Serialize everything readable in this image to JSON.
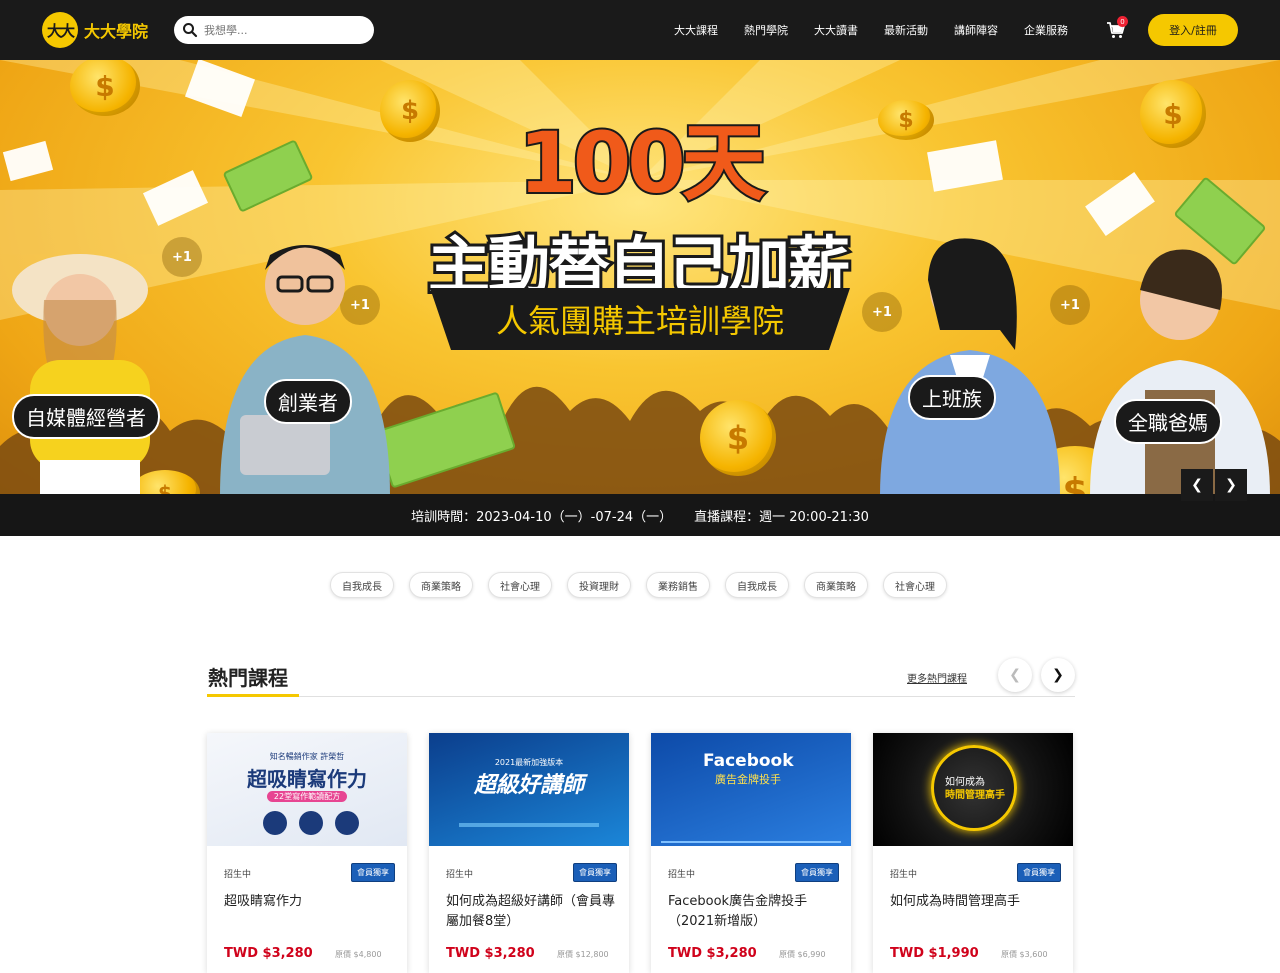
{
  "nav": {
    "logo_mark": "大大",
    "logo_text": "大大學院",
    "search_placeholder": "我想學...",
    "links": [
      "大大課程",
      "熱門學院",
      "大大讀書",
      "最新活動",
      "講師陣容",
      "企業服務"
    ],
    "cart_count": "0",
    "login_label": "登入/註冊"
  },
  "hero": {
    "title": "100天",
    "subtitle": "主動替自己加薪",
    "tagline": "人氣團購主培訓學院",
    "personas": [
      "自媒體經營者",
      "創業者",
      "上班族",
      "全職爸媽"
    ],
    "plus_one": "+1",
    "training_time": "培訓時間：2023-04-10（一）-07-24（一）",
    "live_time": "直播課程：週一 20:00-21:30",
    "prev_icon": "chevron-left-icon",
    "next_icon": "chevron-right-icon"
  },
  "categories": [
    "自我成長",
    "商業策略",
    "社會心理",
    "投資理財",
    "業務銷售",
    "自我成長",
    "商業策略",
    "社會心理"
  ],
  "section": {
    "title": "熱門課程",
    "more_label": "更多熱門課程"
  },
  "courses": [
    {
      "status": "招生中",
      "badge": "會員獨享",
      "title": "超吸睛寫作力",
      "price": "TWD $3,280",
      "original": "原價 $4,800",
      "img_line1": "知名暢銷作家 許榮哲",
      "img_line2": "超吸睛寫作力",
      "img_line3": "22堂寫作範讀配方"
    },
    {
      "status": "招生中",
      "badge": "會員獨享",
      "title": "如何成為超級好講師（會員專屬加餐8堂）",
      "price": "TWD $3,280",
      "original": "原價 $12,800",
      "img_line1": "2021最新加強版本",
      "img_line2": "超級好講師"
    },
    {
      "status": "招生中",
      "badge": "會員獨享",
      "title": "Facebook廣告金牌投手（2021新增版）",
      "price": "TWD $3,280",
      "original": "原價 $6,990",
      "img_line1": "Facebook",
      "img_line2": "廣告金牌投手"
    },
    {
      "status": "招生中",
      "badge": "會員獨享",
      "title": "如何成為時間管理高手",
      "price": "TWD $1,990",
      "original": "原價 $3,600",
      "img_line1": "如何成為",
      "img_line2": "時間管理高手"
    }
  ],
  "colors": {
    "brand_yellow": "#f5c800",
    "header_dark": "#1a1a1a",
    "price_red": "#d0021b",
    "badge_blue": "#1b5fb8"
  }
}
